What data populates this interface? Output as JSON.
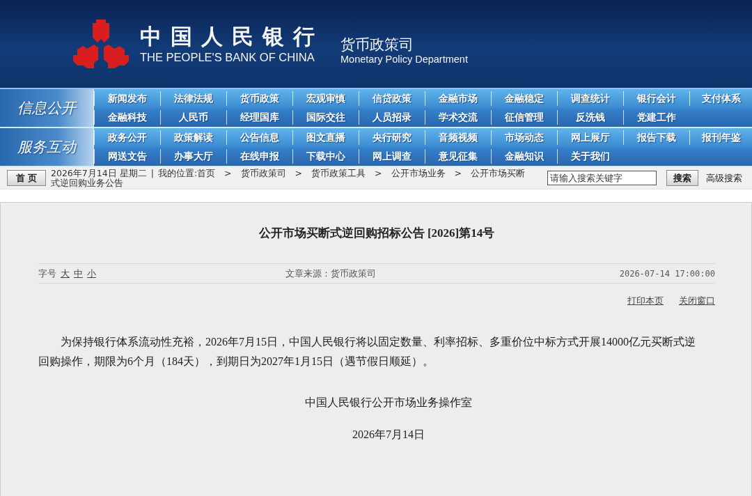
{
  "header": {
    "bank_name": "中国人民银行",
    "bank_name_en": "THE PEOPLE'S BANK OF CHINA",
    "department": "货币政策司",
    "department_en": "Monetary Policy Department"
  },
  "nav_sections": [
    {
      "title": "信息公开",
      "items": [
        "新闻发布",
        "法律法规",
        "货币政策",
        "宏观审慎",
        "信贷政策",
        "金融市场",
        "金融稳定",
        "调查统计",
        "银行会计",
        "支付体系",
        "金融科技",
        "人民币",
        "经理国库",
        "国际交往",
        "人员招录",
        "学术交流",
        "征信管理",
        "反洗钱",
        "党建工作"
      ]
    },
    {
      "title": "服务互动",
      "items": [
        "政务公开",
        "政策解读",
        "公告信息",
        "图文直播",
        "央行研究",
        "音频视频",
        "市场动态",
        "网上展厅",
        "报告下载",
        "报刊年鉴",
        "网送文告",
        "办事大厅",
        "在线申报",
        "下载中心",
        "网上调查",
        "意见征集",
        "金融知识",
        "关于我们"
      ]
    }
  ],
  "toolbar": {
    "home_button": "首 页",
    "date": "2026年7月14日 星期二",
    "divider": "|",
    "location_label": "我的位置:",
    "breadcrumb": [
      "首页",
      "货币政策司",
      "货币政策工具",
      "公开市场业务",
      "公开市场买断式逆回购业务公告"
    ],
    "breadcrumb_separator": ">",
    "search": {
      "placeholder": "请输入搜索关键字"
    },
    "search_button": "搜索",
    "advanced_search": "高级搜索"
  },
  "article": {
    "title": "公开市场买断式逆回购招标公告 [2026]第14号",
    "reading_controls": {
      "label": "字号",
      "links": [
        "大",
        "中",
        "小"
      ]
    },
    "source": "文章来源：货币政策司",
    "published": "2026-07-14 17:00:00",
    "actions": [
      "打印本页",
      "关闭窗口"
    ],
    "body": [
      "为保持银行体系流动性充裕，2026年7月15日，中国人民银行将以固定数量、利率招标、多重价位中标方式开展14000亿元买断式逆回购操作，期限为6个月（184天），到期日为2027年1月15日（遇节假日顺延）。"
    ],
    "signature": "中国人民银行公开市场业务操作室",
    "date": "2026年7月14日"
  }
}
